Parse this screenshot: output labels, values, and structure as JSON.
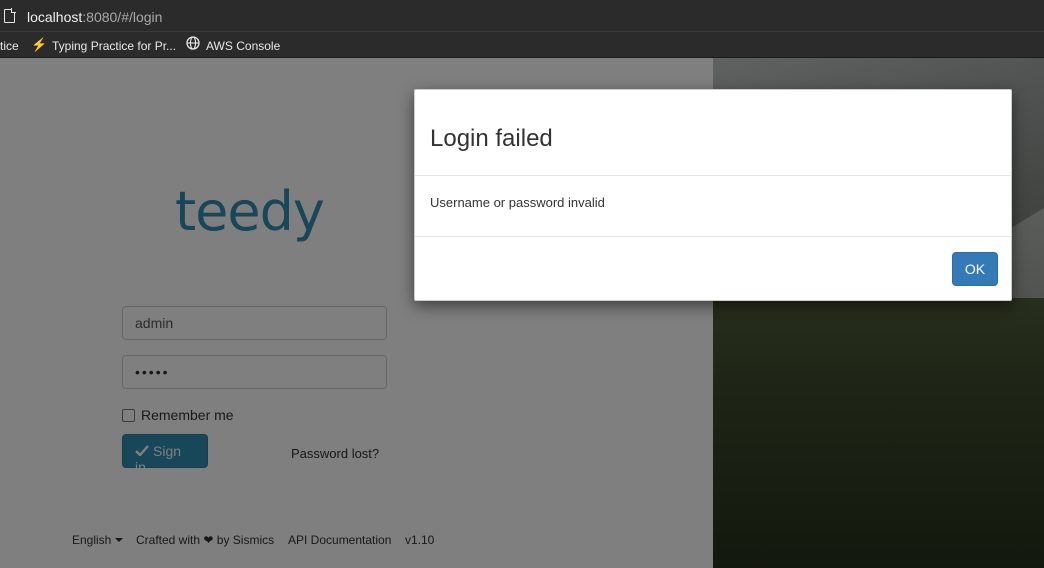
{
  "browser": {
    "url_host": "localhost",
    "url_rest": ":8080/#/login",
    "bookmarks": [
      {
        "label": "tice"
      },
      {
        "label": "Typing Practice for Pr..."
      },
      {
        "label": "AWS Console"
      }
    ]
  },
  "login": {
    "logo": "teedy",
    "username_value": "admin",
    "password_value": "•••••",
    "remember_label": "Remember me",
    "signin_label": "Sign in",
    "password_lost": "Password lost?"
  },
  "footer": {
    "language": "English",
    "crafted_prefix": "Crafted with",
    "crafted_suffix": "by Sismics",
    "api_docs": "API Documentation",
    "version": "v1.10"
  },
  "modal": {
    "title": "Login failed",
    "message": "Username or password invalid",
    "ok_label": "OK"
  }
}
